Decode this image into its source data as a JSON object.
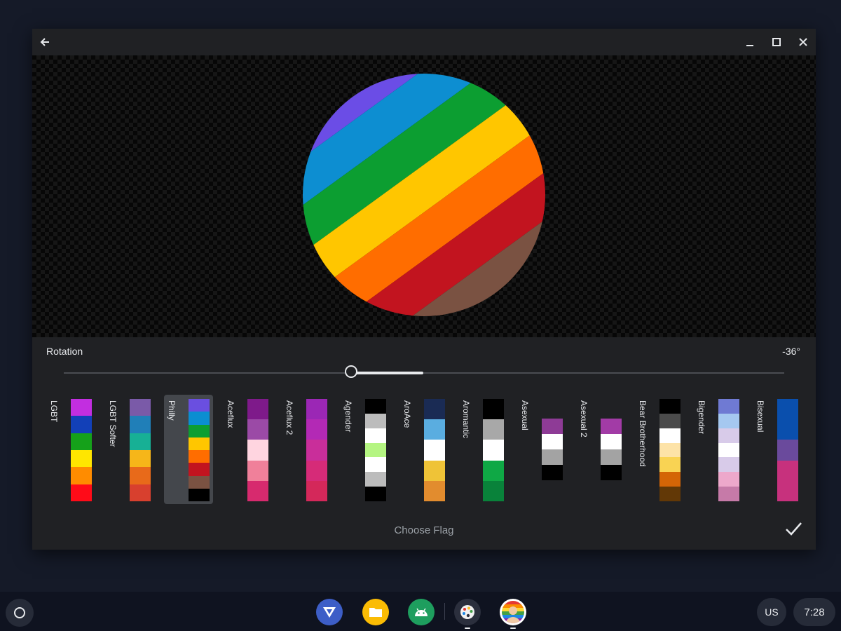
{
  "editor": {
    "rotation_label": "Rotation",
    "rotation_value": "-36°",
    "rotation_degrees": -36,
    "choose_flag_label": "Choose Flag"
  },
  "preview_colors": [
    "#6b4de6",
    "#0d8ed1",
    "#0c9e31",
    "#ffc600",
    "#ff6d00",
    "#c2141f",
    "#7a5242",
    "#000000"
  ],
  "flags": [
    {
      "name": "LGBT",
      "selected": false,
      "colors": [
        "#c22ee0",
        "#1240b8",
        "#15a11a",
        "#ffe600",
        "#ff8c00",
        "#ff0b18"
      ]
    },
    {
      "name": "LGBT Softer",
      "selected": false,
      "colors": [
        "#7a5aa8",
        "#207fb8",
        "#17b095",
        "#f6b619",
        "#e86a1a",
        "#d8402e"
      ]
    },
    {
      "name": "Philly",
      "selected": true,
      "colors": [
        "#6a4fe0",
        "#0b8ed1",
        "#0c9e31",
        "#ffc600",
        "#ff6d00",
        "#c2141f",
        "#7a5242",
        "#000000"
      ]
    },
    {
      "name": "Aceflux",
      "selected": false,
      "colors": [
        "#7e1a8a",
        "#9b4aa6",
        "#ffd5e0",
        "#f0809a",
        "#d72a6e"
      ]
    },
    {
      "name": "Aceflux 2",
      "selected": false,
      "colors": [
        "#9b27b5",
        "#b329b5",
        "#c92e9a",
        "#d62b78",
        "#d4285a"
      ]
    },
    {
      "name": "Agender",
      "selected": false,
      "colors": [
        "#000000",
        "#bcbcbc",
        "#ffffff",
        "#b5f582",
        "#ffffff",
        "#bcbcbc",
        "#000000"
      ]
    },
    {
      "name": "AroAce",
      "selected": false,
      "colors": [
        "#1a2b54",
        "#5aade0",
        "#ffffff",
        "#efc337",
        "#e28c2e"
      ]
    },
    {
      "name": "Aromantic",
      "selected": false,
      "colors": [
        "#000000",
        "#a8a8a8",
        "#ffffff",
        "#0fa845",
        "#09823a"
      ]
    },
    {
      "name": "Asexual",
      "selected": false,
      "colors": [
        "#8e3b96",
        "#ffffff",
        "#a3a3a3",
        "#000000"
      ]
    },
    {
      "name": "Asexual 2",
      "selected": false,
      "colors": [
        "#a23ba6",
        "#ffffff",
        "#a3a3a3",
        "#000000"
      ]
    },
    {
      "name": "Bear Brotherhood",
      "selected": false,
      "colors": [
        "#000000",
        "#4b4b4b",
        "#ffffff",
        "#fde3a8",
        "#f9d353",
        "#d46506",
        "#623806"
      ]
    },
    {
      "name": "Bigender",
      "selected": false,
      "colors": [
        "#6f7ad3",
        "#a5c8f0",
        "#d8cbe9",
        "#ffffff",
        "#d8cbe9",
        "#eda8cb",
        "#c67aa8"
      ]
    },
    {
      "name": "Bisexual",
      "selected": false,
      "colors": [
        "#0a4fad",
        "#0a4fad",
        "#6a4a9c",
        "#c7317d",
        "#c7317d"
      ]
    }
  ],
  "shelf": {
    "ime_label": "US",
    "time": "7:28",
    "apps": [
      "vpn-app",
      "files-app",
      "play-store-app",
      "paint-app",
      "flag-avatar-app"
    ]
  }
}
